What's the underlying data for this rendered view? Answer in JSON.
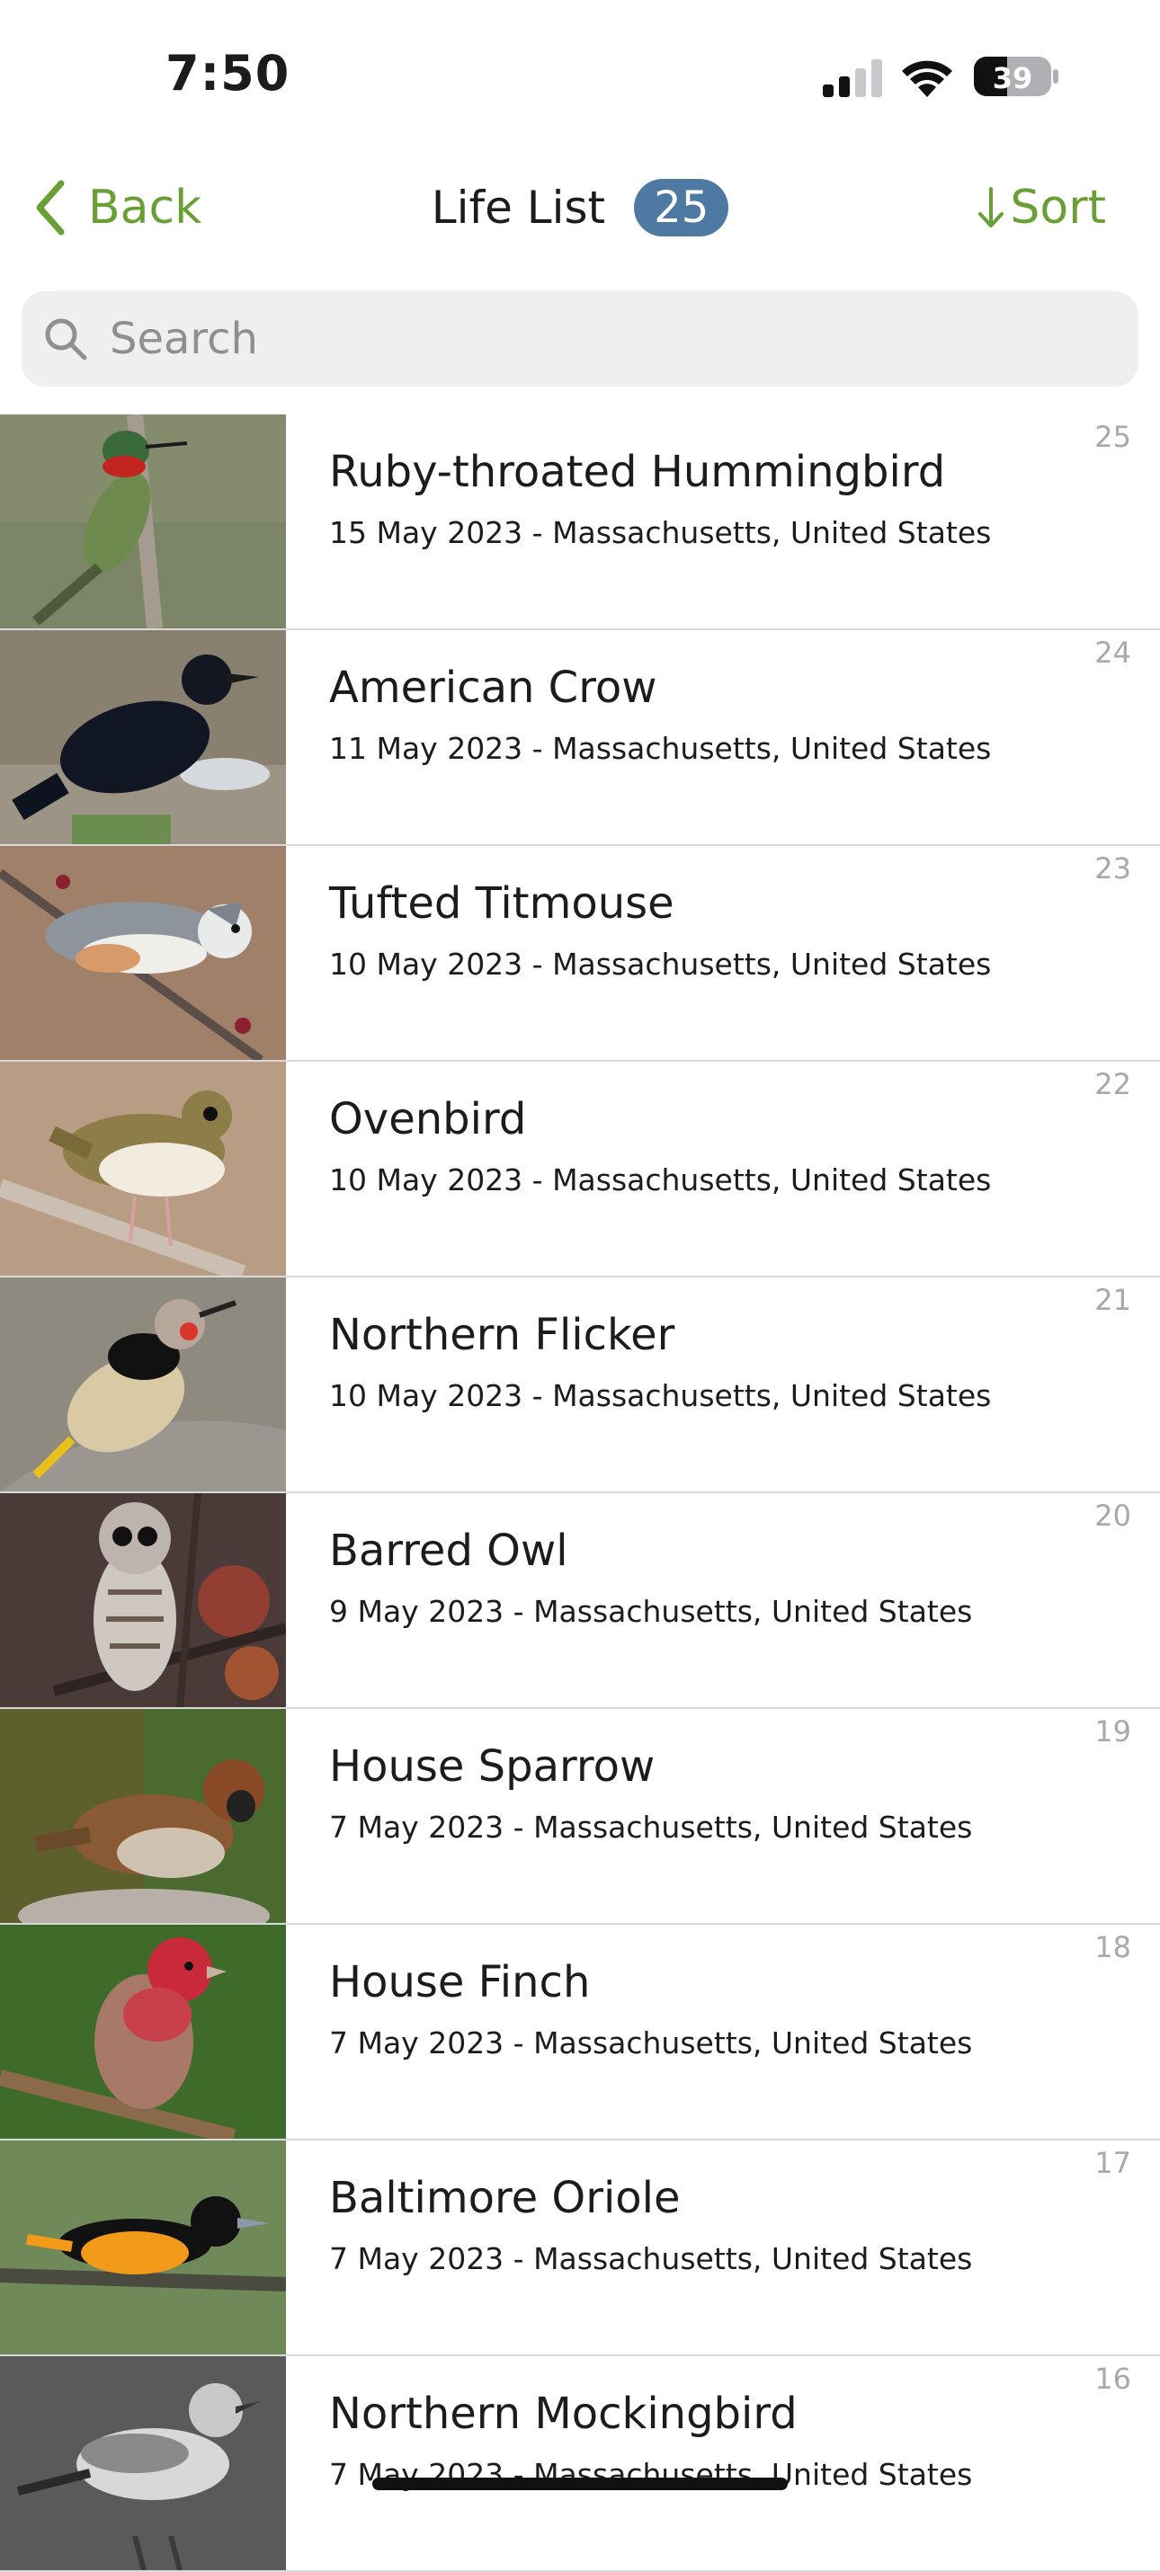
{
  "status_bar": {
    "time": "7:50",
    "battery": "39",
    "icons": [
      "cellular-signal-icon",
      "wifi-icon",
      "battery-icon"
    ]
  },
  "nav": {
    "back_label": "Back",
    "title": "Life List",
    "count": "25",
    "sort_label": "Sort"
  },
  "search": {
    "placeholder": "Search",
    "value": ""
  },
  "colors": {
    "accent": "#6a9f35",
    "badge": "#4d79a3"
  },
  "birds": [
    {
      "name": "Ruby-throated Hummingbird",
      "detail": "15 May 2023 - Massachusetts, United States",
      "number": "25"
    },
    {
      "name": "American Crow",
      "detail": "11 May 2023 - Massachusetts, United States",
      "number": "24"
    },
    {
      "name": "Tufted Titmouse",
      "detail": "10 May 2023 - Massachusetts, United States",
      "number": "23"
    },
    {
      "name": "Ovenbird",
      "detail": "10 May 2023 - Massachusetts, United States",
      "number": "22"
    },
    {
      "name": "Northern Flicker",
      "detail": "10 May 2023 - Massachusetts, United States",
      "number": "21"
    },
    {
      "name": "Barred Owl",
      "detail": "9 May 2023 - Massachusetts, United States",
      "number": "20"
    },
    {
      "name": "House Sparrow",
      "detail": "7 May 2023 - Massachusetts, United States",
      "number": "19"
    },
    {
      "name": "House Finch",
      "detail": "7 May 2023 - Massachusetts, United States",
      "number": "18"
    },
    {
      "name": "Baltimore Oriole",
      "detail": "7 May 2023 - Massachusetts, United States",
      "number": "17"
    },
    {
      "name": "Northern Mockingbird",
      "detail": "7 May 2023 - Massachusetts, United States",
      "number": "16"
    }
  ]
}
